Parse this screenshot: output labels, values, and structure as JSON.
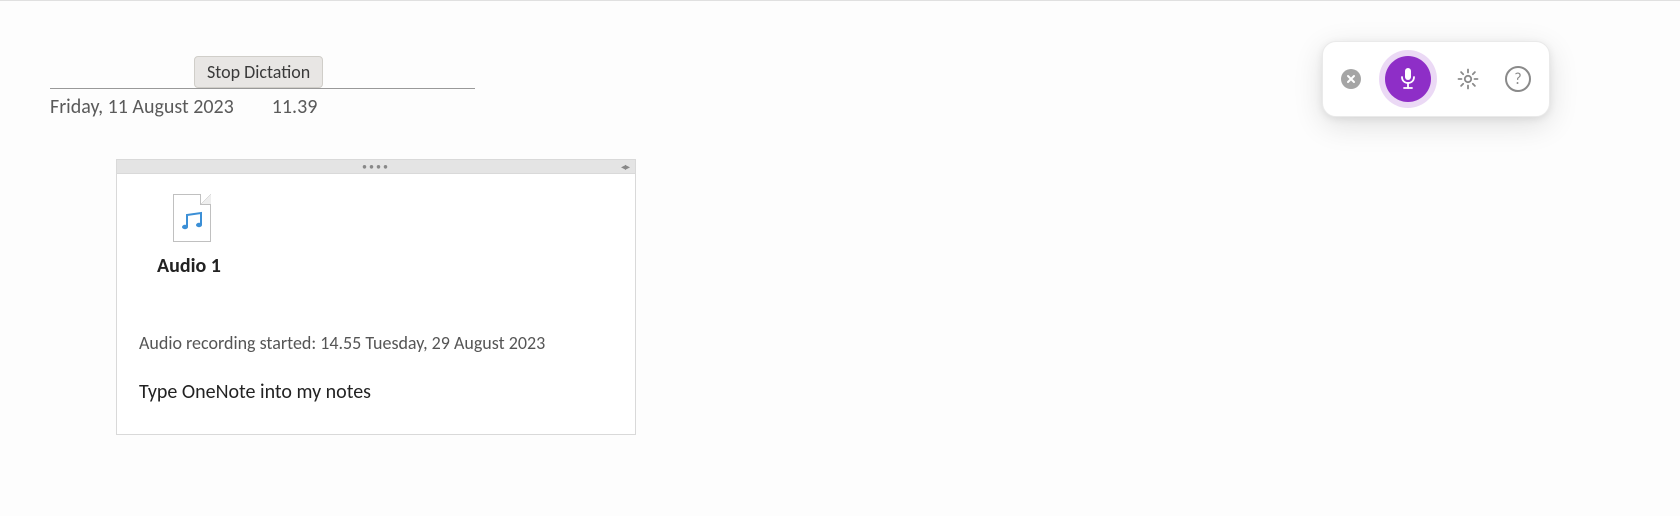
{
  "tooltip": {
    "label": "Stop Dictation"
  },
  "page": {
    "date": "Friday, 11 August 2023",
    "time": "11.39"
  },
  "content": {
    "audio_label": "Audio 1",
    "recording_status": "Audio recording started: 14.55 Tuesday, 29 August 2023",
    "note_text": "Type OneNote into my notes"
  },
  "toolbar": {
    "close_icon": "close-icon",
    "mic_icon": "microphone-icon",
    "settings_icon": "gear-icon",
    "help_icon": "help-icon",
    "help_glyph": "?"
  },
  "colors": {
    "accent": "#8e2ec7"
  }
}
